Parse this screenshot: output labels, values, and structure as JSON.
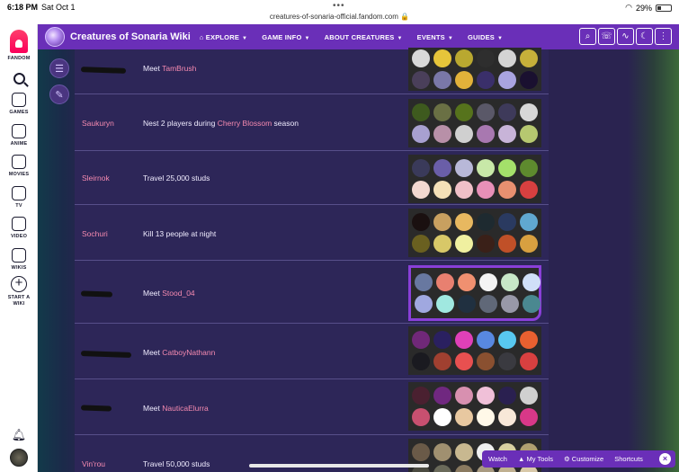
{
  "status": {
    "time": "6:18 PM",
    "date": "Sat Oct 1",
    "url": "creatures-of-sonaria-official.fandom.com 🔒",
    "battery": "29%"
  },
  "rail": {
    "brand": "FANDOM",
    "items": [
      {
        "label": "GAMES",
        "icon": "gamepad-icon"
      },
      {
        "label": "ANIME",
        "icon": "anime-icon"
      },
      {
        "label": "MOVIES",
        "icon": "clapper-icon"
      },
      {
        "label": "TV",
        "icon": "tv-icon"
      },
      {
        "label": "VIDEO",
        "icon": "play-icon"
      },
      {
        "label": "WIKIS",
        "icon": "book-icon"
      }
    ],
    "start_wiki": "START A WIKI"
  },
  "header": {
    "wiki_name": "Creatures of Sonaria Wiki",
    "nav": [
      "EXPLORE",
      "GAME INFO",
      "ABOUT CREATURES",
      "EVENTS",
      "GUIDES"
    ]
  },
  "rows": [
    {
      "name": "",
      "redacted": true,
      "req_prefix": "Meet ",
      "req_link": "TamBrush",
      "req_suffix": "",
      "colors": [
        "#d8d8d8",
        "#e6c53a",
        "#b9a830",
        "#2e2e2e",
        "#d4d4d4",
        "#c6b03a",
        "#4a3f5a",
        "#7a78a8",
        "#e2b23a",
        "#3a2f6a",
        "#a9a4e0",
        "#1a1030"
      ]
    },
    {
      "name": "Saukuryn",
      "req_prefix": "Nest 2 players during ",
      "req_link": "Cherry Blossom",
      "req_suffix": " season",
      "colors": [
        "#3e5a1e",
        "#6a7044",
        "#56731c",
        "#5a5868",
        "#3e3a5a",
        "#d8d8d8",
        "#a8a0d0",
        "#b890a8",
        "#d0d0d0",
        "#a878b0",
        "#c8b4d8",
        "#b6c870"
      ]
    },
    {
      "name": "Sleirnok",
      "req_prefix": "Travel 25,000 studs",
      "req_link": "",
      "req_suffix": "",
      "colors": [
        "#3a3a5a",
        "#6a5ea8",
        "#b8b8d8",
        "#c8e8a8",
        "#a4e06a",
        "#5e8a2e",
        "#f2d8d0",
        "#f4e0b8",
        "#f0c0c8",
        "#e890b8",
        "#e89070",
        "#d84040"
      ]
    },
    {
      "name": "Sochuri",
      "req_prefix": "Kill 13 people at night",
      "req_link": "",
      "req_suffix": "",
      "colors": [
        "#1a1010",
        "#c8a060",
        "#e8b860",
        "#1e2a30",
        "#2a3a60",
        "#60a8d0",
        "#6a6020",
        "#d8c868",
        "#f0f0a0",
        "#3a2018",
        "#c05028",
        "#d8a040"
      ]
    },
    {
      "name": "",
      "redacted": true,
      "req_prefix": "Meet ",
      "req_link": "Stood_04",
      "req_suffix": "",
      "colors": [
        "#6878a0",
        "#e88070",
        "#f09070",
        "#f4f4f4",
        "#c8e8c8",
        "#d0e0f8",
        "#a0a8e0",
        "#a0e8e0",
        "#203040",
        "#606878",
        "#9898a8",
        "#4a8890"
      ]
    },
    {
      "name": "",
      "redacted": true,
      "req_prefix": "Meet ",
      "req_link": "CatboyNathann",
      "req_suffix": "",
      "colors": [
        "#702878",
        "#2a2060",
        "#e040b8",
        "#5888e0",
        "#58c8f0",
        "#e86030",
        "#1a1a20",
        "#a04030",
        "#e85050",
        "#8a5030",
        "#3a3a40",
        "#d84040"
      ]
    },
    {
      "name": "",
      "redacted": true,
      "req_prefix": "Meet ",
      "req_link": "NauticaElurra",
      "req_suffix": "",
      "colors": [
        "#4a2030",
        "#702880",
        "#d890b0",
        "#f0c0d8",
        "#2a2050",
        "#d0d0d0",
        "#c85070",
        "#ffffff",
        "#e8c8a0",
        "#fff8e8",
        "#f8e8d8",
        "#d83888"
      ]
    },
    {
      "name": "Vin'rou",
      "req_prefix": "Travel 50,000 studs",
      "req_link": "",
      "req_suffix": "",
      "colors": [
        "#6a5a48",
        "#a09070",
        "#c8b890",
        "#f0f0f0",
        "#d8d0a0",
        "#b0a070",
        "#4a4a40",
        "#6a6a5a",
        "#8a7a60",
        "#a89a80",
        "#c0b090",
        "#d8c8a8"
      ]
    }
  ],
  "bottom_toolbar": [
    "Watch",
    "My Tools",
    "Customize",
    "Shortcuts"
  ]
}
